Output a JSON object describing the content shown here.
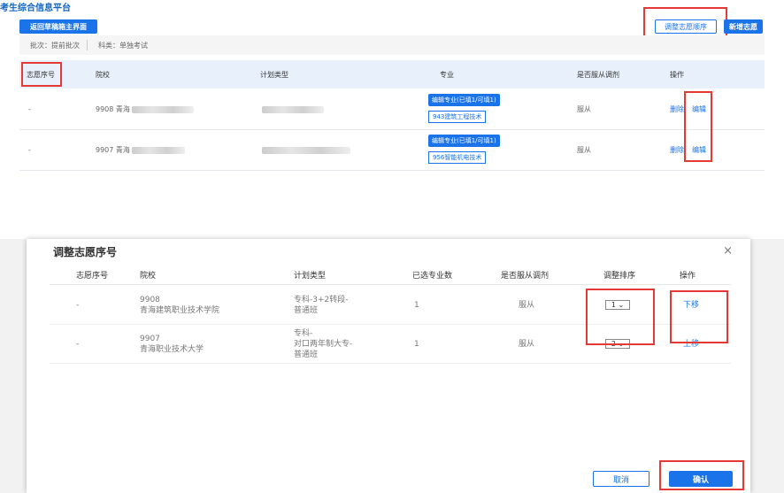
{
  "app": {
    "title": "考生综合信息平台"
  },
  "toolbar": {
    "back_label": "返回草稿箱主界面",
    "adjust_order_label": "调整志愿顺序",
    "new_label": "新增志愿"
  },
  "info": {
    "batch": "批次：提前批次",
    "subject": "科类：单独考试"
  },
  "table": {
    "headers": [
      "志愿序号",
      "院校",
      "计划类型",
      "专业",
      "是否服从调剂",
      "操作"
    ],
    "rows": [
      {
        "seq": "-",
        "school": "9908 青海",
        "edit_major": "编辑专业(已填1/可填1)",
        "major": "943建筑工程技术",
        "obey": "服从",
        "delete": "删除",
        "edit": "编辑"
      },
      {
        "seq": "-",
        "school": "9907 青海",
        "edit_major": "编辑专业(已填1/可填1)",
        "major": "956智能机电技术",
        "obey": "服从",
        "delete": "删除",
        "edit": "编辑"
      }
    ]
  },
  "modal": {
    "title": "调整志愿序号",
    "close": "×",
    "headers": [
      "志愿序号",
      "院校",
      "计划类型",
      "已选专业数",
      "是否服从调剂",
      "调整排序",
      "操作"
    ],
    "rows": [
      {
        "seq": "-",
        "school_code": "9908",
        "school_name": "青海建筑职业技术学院",
        "plan_line1": "专科-3+2转段-",
        "plan_line2": "普通班",
        "plan_line3": "",
        "count": "1",
        "obey": "服从",
        "order": "1",
        "action": "下移"
      },
      {
        "seq": "-",
        "school_code": "9907",
        "school_name": "青海职业技术大学",
        "plan_line1": "专科-",
        "plan_line2": "对口两年制大专-",
        "plan_line3": "普通班",
        "count": "1",
        "obey": "服从",
        "order": "2",
        "action": "上移"
      }
    ],
    "cancel_label": "取消",
    "confirm_label": "确认"
  }
}
